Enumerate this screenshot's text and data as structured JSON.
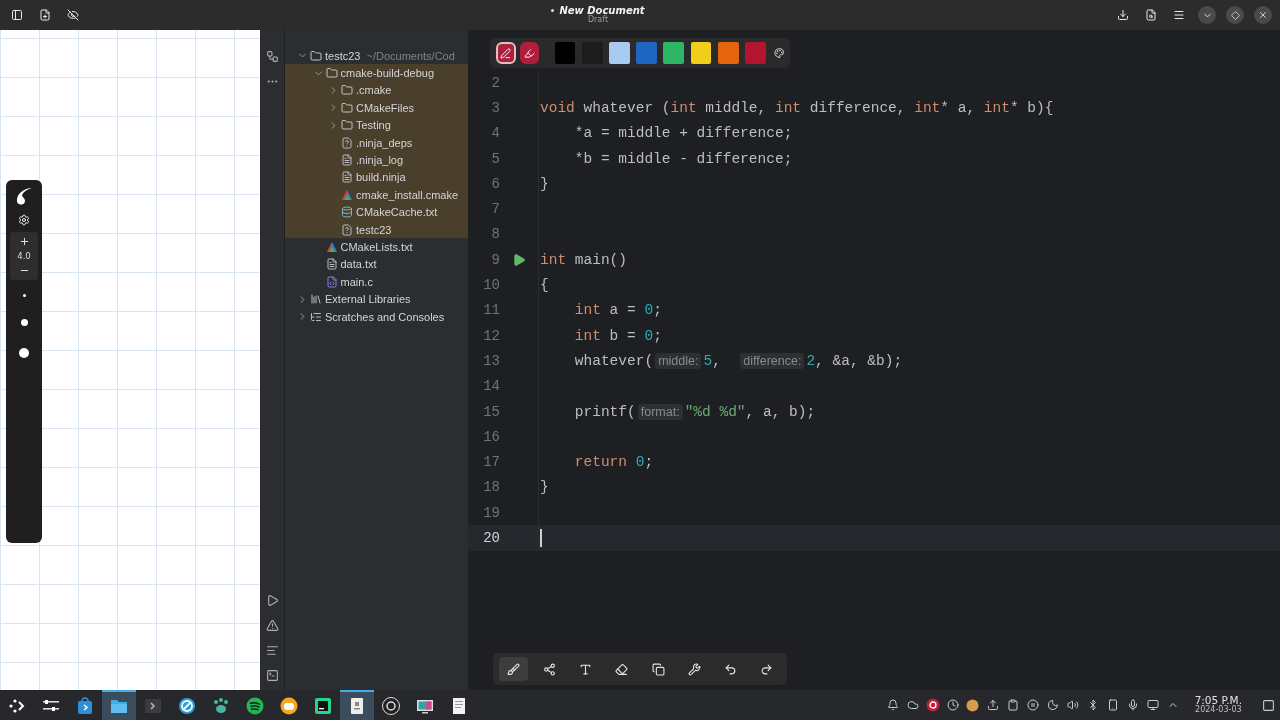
{
  "header": {
    "title": "New Document",
    "subtitle": "Draft",
    "unsaved": true
  },
  "canvas_toolbar": {
    "zoom": "4.0"
  },
  "palette": {
    "tools": [
      {
        "kind": "pen",
        "selected": true
      },
      {
        "kind": "marker",
        "selected": false
      }
    ],
    "colors": [
      {
        "color": "#000000"
      },
      {
        "color": "#1c1c1c"
      },
      {
        "color": "#a9cbf2"
      },
      {
        "color": "#1f66c1"
      },
      {
        "color": "#2fb566"
      },
      {
        "color": "#f1cd1c"
      },
      {
        "color": "#e5650f"
      },
      {
        "color": "#b3142f"
      }
    ]
  },
  "project_tree": [
    {
      "label": "testc23",
      "path": "~/Documents/Cod",
      "kind": "folder",
      "expanded": true,
      "children": [
        {
          "label": "cmake-build-debug",
          "kind": "folder",
          "expanded": true,
          "excluded": true,
          "children": [
            {
              "label": ".cmake",
              "kind": "folder",
              "expanded": false
            },
            {
              "label": "CMakeFiles",
              "kind": "folder",
              "expanded": false
            },
            {
              "label": "Testing",
              "kind": "folder",
              "expanded": false
            },
            {
              "label": ".ninja_deps",
              "kind": "unknown"
            },
            {
              "label": ".ninja_log",
              "kind": "text"
            },
            {
              "label": "build.ninja",
              "kind": "text"
            },
            {
              "label": "cmake_install.cmake",
              "kind": "cmake"
            },
            {
              "label": "CMakeCache.txt",
              "kind": "cache"
            },
            {
              "label": "testc23",
              "kind": "unknown"
            }
          ]
        },
        {
          "label": "CMakeLists.txt",
          "kind": "cmake"
        },
        {
          "label": "data.txt",
          "kind": "text"
        },
        {
          "label": "main.c",
          "kind": "c"
        }
      ]
    },
    {
      "label": "External Libraries",
      "kind": "library",
      "expanded": false
    },
    {
      "label": "Scratches and Consoles",
      "kind": "scratches",
      "expanded": false
    }
  ],
  "editor": {
    "lines": [
      {
        "number": "2",
        "run_button": false,
        "current": false
      },
      {
        "number": "3",
        "run_button": false,
        "current": false,
        "tokens": [
          {
            "kind": "keyword",
            "text": "void"
          },
          {
            "kind": "plain",
            "text": " whatever ("
          },
          {
            "kind": "keyword",
            "text": "int"
          },
          {
            "kind": "plain",
            "text": " middle, "
          },
          {
            "kind": "keyword",
            "text": "int"
          },
          {
            "kind": "plain",
            "text": " difference, "
          },
          {
            "kind": "keyword",
            "text": "int"
          },
          {
            "kind": "plain",
            "text": "* a, "
          },
          {
            "kind": "keyword",
            "text": "int"
          },
          {
            "kind": "plain",
            "text": "* b){"
          }
        ]
      },
      {
        "number": "4",
        "run_button": false,
        "current": false,
        "indented": true,
        "tokens": [
          {
            "kind": "plain",
            "text": "*a = middle + difference;"
          }
        ]
      },
      {
        "number": "5",
        "run_button": false,
        "current": false,
        "indented": true,
        "tokens": [
          {
            "kind": "plain",
            "text": "*b = middle - difference;"
          }
        ]
      },
      {
        "number": "6",
        "run_button": false,
        "current": false,
        "tokens": [
          {
            "kind": "plain",
            "text": "}"
          }
        ]
      },
      {
        "number": "7",
        "run_button": false,
        "current": false
      },
      {
        "number": "8",
        "run_button": false,
        "current": false
      },
      {
        "number": "9",
        "run_button": true,
        "current": false,
        "tokens": [
          {
            "kind": "keyword",
            "text": "int"
          },
          {
            "kind": "plain",
            "text": " main()"
          }
        ]
      },
      {
        "number": "10",
        "run_button": false,
        "current": false,
        "tokens": [
          {
            "kind": "plain",
            "text": "{"
          }
        ]
      },
      {
        "number": "11",
        "run_button": false,
        "current": false,
        "indented": true,
        "tokens": [
          {
            "kind": "keyword",
            "text": "int"
          },
          {
            "kind": "plain",
            "text": " a = "
          },
          {
            "kind": "number",
            "text": "0"
          },
          {
            "kind": "plain",
            "text": ";"
          }
        ]
      },
      {
        "number": "12",
        "run_button": false,
        "current": false,
        "indented": true,
        "tokens": [
          {
            "kind": "keyword",
            "text": "int"
          },
          {
            "kind": "plain",
            "text": " b = "
          },
          {
            "kind": "number",
            "text": "0"
          },
          {
            "kind": "plain",
            "text": ";"
          }
        ]
      },
      {
        "number": "13",
        "run_button": false,
        "current": false,
        "indented": true,
        "tokens": [
          {
            "kind": "plain",
            "text": "whatever("
          },
          {
            "kind": "hint",
            "text": "middle:"
          },
          {
            "kind": "number",
            "text": "5"
          },
          {
            "kind": "plain",
            "text": ",  "
          },
          {
            "kind": "hint",
            "text": "difference:"
          },
          {
            "kind": "number",
            "text": "2"
          },
          {
            "kind": "plain",
            "text": ", &a, &b);"
          }
        ]
      },
      {
        "number": "14",
        "run_button": false,
        "current": false
      },
      {
        "number": "15",
        "run_button": false,
        "current": false,
        "indented": true,
        "tokens": [
          {
            "kind": "plain",
            "text": "printf("
          },
          {
            "kind": "hint",
            "text": "format:"
          },
          {
            "kind": "string",
            "text": "\"%d %d\""
          },
          {
            "kind": "plain",
            "text": ", a, b);"
          }
        ]
      },
      {
        "number": "16",
        "run_button": false,
        "current": false
      },
      {
        "number": "17",
        "run_button": false,
        "current": false,
        "indented": true,
        "tokens": [
          {
            "kind": "keyword",
            "text": "return"
          },
          {
            "kind": "number",
            "text": "0",
            "space_before": true
          },
          {
            "kind": "plain",
            "text": ";"
          }
        ]
      },
      {
        "number": "18",
        "run_button": false,
        "current": false,
        "tokens": [
          {
            "kind": "plain",
            "text": "}"
          }
        ]
      },
      {
        "number": "19",
        "run_button": false,
        "current": false
      },
      {
        "number": "20",
        "run_button": false,
        "current": true
      }
    ]
  },
  "drawing_tools": [
    {
      "kind": "brush",
      "selected": true
    },
    {
      "kind": "nodes",
      "selected": false
    },
    {
      "kind": "text",
      "selected": false
    },
    {
      "kind": "eraser",
      "selected": false
    },
    {
      "kind": "copy",
      "selected": false
    },
    {
      "kind": "wrench",
      "selected": false
    },
    {
      "kind": "undo",
      "selected": false
    },
    {
      "kind": "redo",
      "selected": false
    }
  ],
  "taskbar": {
    "apps": [
      {
        "kind": "launcher",
        "active": false
      },
      {
        "kind": "settings",
        "active": false
      },
      {
        "kind": "store",
        "active": false
      },
      {
        "kind": "files",
        "active": true
      },
      {
        "kind": "terminal",
        "active": false
      },
      {
        "kind": "browser",
        "active": false
      },
      {
        "kind": "pets",
        "active": false
      },
      {
        "kind": "music",
        "active": false
      },
      {
        "kind": "chat",
        "active": false
      },
      {
        "kind": "ide",
        "active": false
      },
      {
        "kind": "notes",
        "active": true
      },
      {
        "kind": "obs",
        "active": false
      },
      {
        "kind": "monitor",
        "active": false
      },
      {
        "kind": "document",
        "active": false
      }
    ],
    "tray": [
      {
        "kind": "bell"
      },
      {
        "kind": "cloud"
      },
      {
        "kind": "obs"
      },
      {
        "kind": "clock"
      },
      {
        "kind": "avatar"
      },
      {
        "kind": "upload"
      },
      {
        "kind": "clipboard"
      },
      {
        "kind": "pause"
      },
      {
        "kind": "moon"
      },
      {
        "kind": "volume"
      },
      {
        "kind": "bluetooth"
      },
      {
        "kind": "phone"
      },
      {
        "kind": "mic"
      },
      {
        "kind": "network"
      },
      {
        "kind": "expand"
      }
    ],
    "clock": {
      "time": "7:05 P.M.",
      "date": "2024-03-03"
    }
  }
}
